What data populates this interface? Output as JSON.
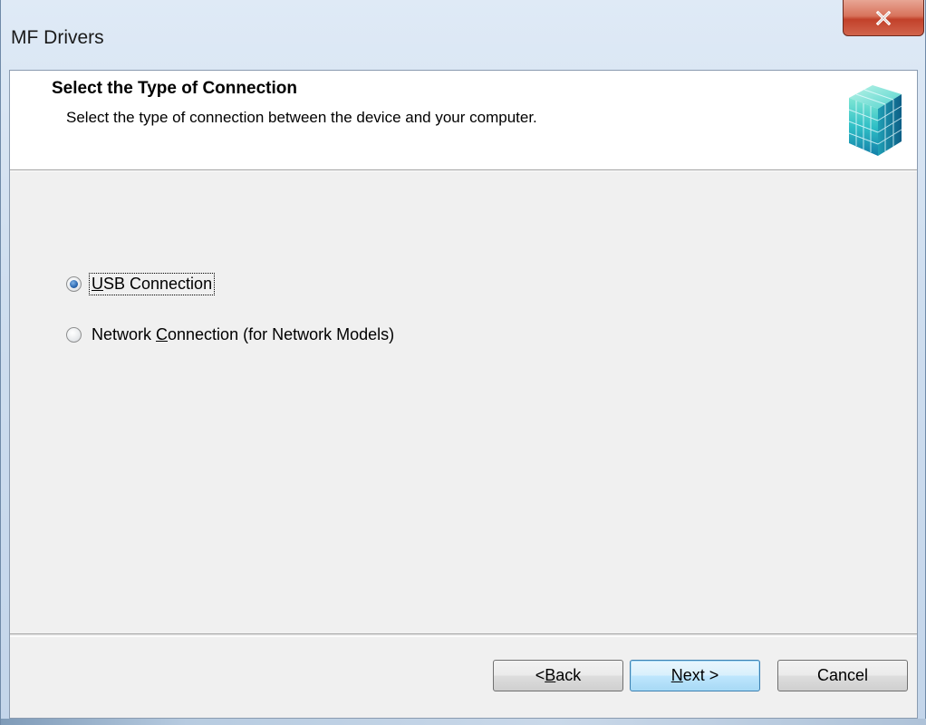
{
  "window": {
    "title": "MF Drivers",
    "close_label": "close"
  },
  "header": {
    "title": "Select the Type of Connection",
    "subtitle": "Select the type of connection between the device and your computer.",
    "icon": "cube-grid-icon"
  },
  "options": [
    {
      "label_pre": "",
      "label_accel": "U",
      "label_post": "SB Connection",
      "selected": true
    },
    {
      "label_pre": "Network ",
      "label_accel": "C",
      "label_post": "onnection (for Network Models)",
      "selected": false
    }
  ],
  "buttons": {
    "back": {
      "pre": "< ",
      "accel": "B",
      "post": "ack"
    },
    "next": {
      "pre": "",
      "accel": "N",
      "post": "ext >"
    },
    "cancel": {
      "label": "Cancel"
    }
  },
  "colors": {
    "default_button_border": "#3c7fb1",
    "close_button": "#c2412a",
    "radio_selected": "#2a67b0"
  }
}
